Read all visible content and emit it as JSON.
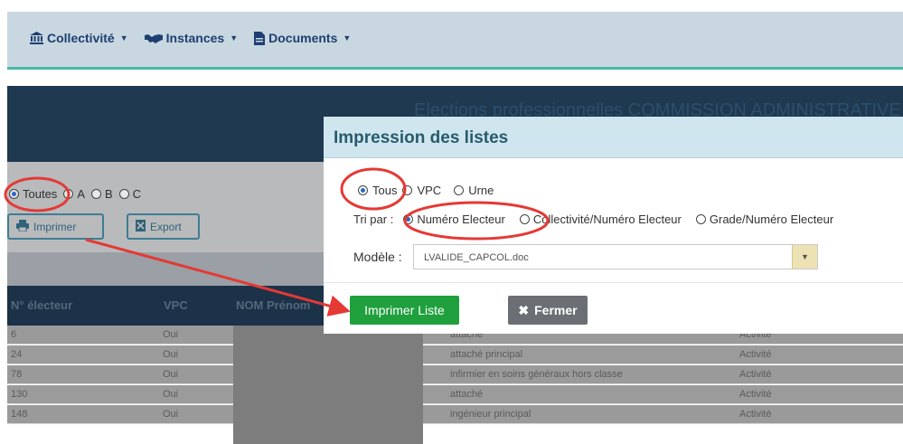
{
  "nav": {
    "items": [
      {
        "label": "Collectivité",
        "icon": "bank-icon"
      },
      {
        "label": "Instances",
        "icon": "handshake-icon"
      },
      {
        "label": "Documents",
        "icon": "document-icon"
      }
    ]
  },
  "page": {
    "banner_title": "Elections professionnelles COMMISSION ADMINISTRATIVE",
    "filters": [
      "Toutes",
      "A",
      "B",
      "C"
    ],
    "print_button": "Imprimer",
    "export_button": "Export",
    "columns": [
      "N° électeur",
      "VPC",
      "NOM Prénom"
    ],
    "rows": [
      {
        "num": "6",
        "vpc": "Oui",
        "grade": "attaché",
        "position": "Activité"
      },
      {
        "num": "24",
        "vpc": "Oui",
        "grade": "attaché principal",
        "position": "Activité"
      },
      {
        "num": "78",
        "vpc": "Oui",
        "grade": "infirmier en soins généraux hors classe",
        "position": "Activité"
      },
      {
        "num": "130",
        "vpc": "Oui",
        "grade": "attaché",
        "position": "Activité"
      },
      {
        "num": "148",
        "vpc": "Oui",
        "grade": "ingénieur principal",
        "position": "Activité"
      }
    ]
  },
  "modal": {
    "title": "Impression des listes",
    "options": [
      "Tous",
      "VPC",
      "Urne"
    ],
    "selected_option": "Tous",
    "sort_label": "Tri par :",
    "sort_options": [
      "Numéro Electeur",
      "Collectivité/Numéro Electeur",
      "Grade/Numéro Electeur"
    ],
    "selected_sort": "Numéro Electeur",
    "model_label": "Modèle :",
    "model_value": "LVALIDE_CAPCOL.doc",
    "print_button": "Imprimer Liste",
    "close_button": "Fermer"
  },
  "colors": {
    "nav_bg": "#c9d7e0",
    "accent": "#48b9a7",
    "modal_header": "#cfe6ee",
    "green_button": "#1fa03d",
    "gray_button": "#6b6f73",
    "annotation_red": "#e53935"
  }
}
